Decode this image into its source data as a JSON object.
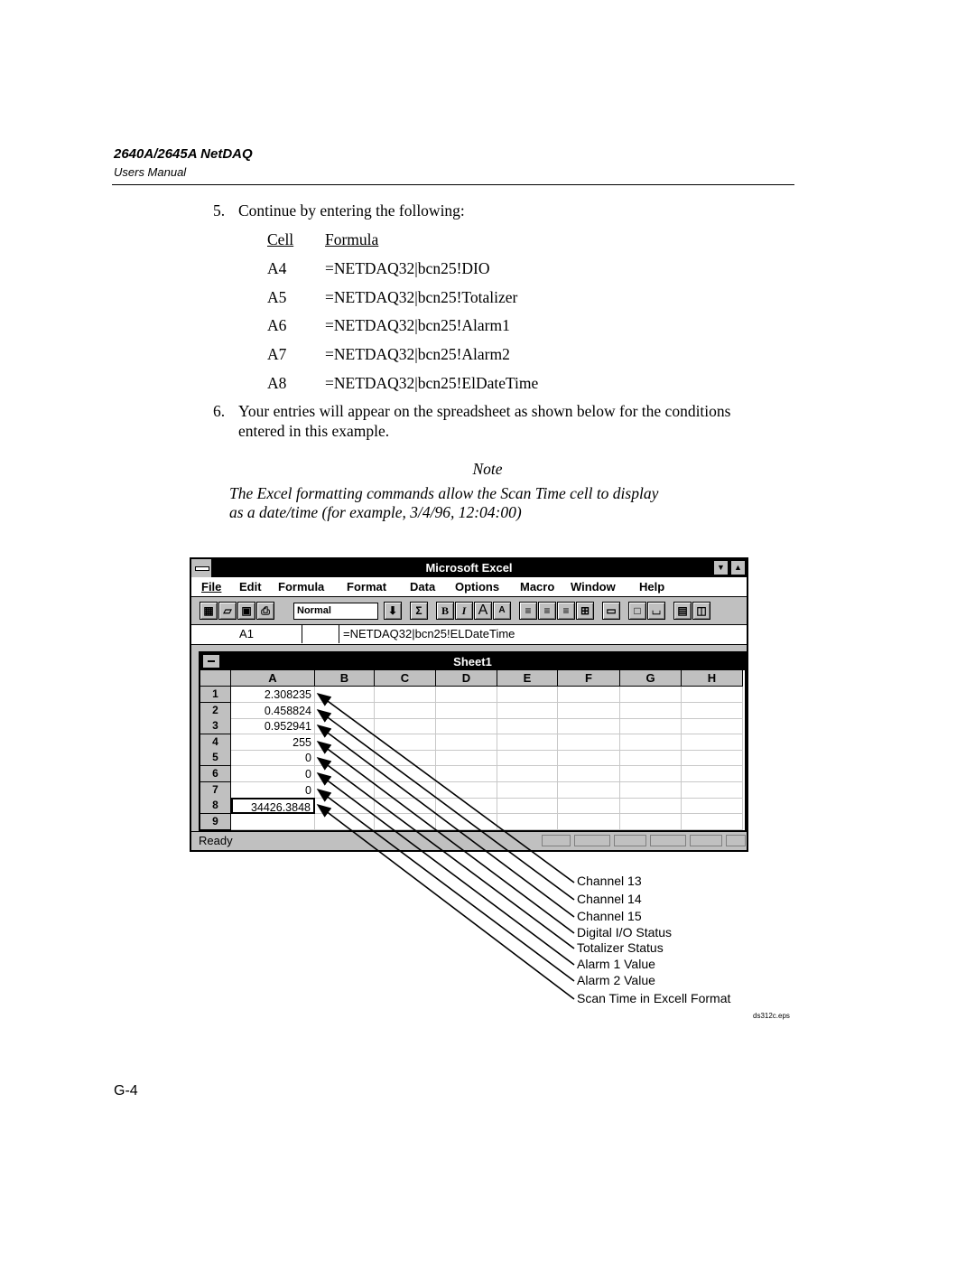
{
  "header": {
    "title": "2640A/2645A NetDAQ",
    "subtitle": "Users Manual"
  },
  "steps": [
    {
      "number": "5.",
      "text": "Continue by entering the following:"
    },
    {
      "number": "6.",
      "lines": [
        "Your entries will appear on the spreadsheet as shown below for the conditions",
        "entered in this example."
      ]
    }
  ],
  "formula_table": {
    "headers": {
      "cell": "Cell",
      "formula": "Formula"
    },
    "rows": [
      {
        "cell": "A4",
        "formula": "=NETDAQ32|bcn25!DIO"
      },
      {
        "cell": "A5",
        "formula": "=NETDAQ32|bcn25!Totalizer"
      },
      {
        "cell": "A6",
        "formula": "=NETDAQ32|bcn25!Alarm1"
      },
      {
        "cell": "A7",
        "formula": "=NETDAQ32|bcn25!Alarm2"
      },
      {
        "cell": "A8",
        "formula": "=NETDAQ32|bcn25!ElDateTime"
      }
    ]
  },
  "note": {
    "title": "Note",
    "lines": [
      "The Excel formatting commands allow the Scan Time cell to display",
      "as a date/time (for example, 3/4/96, 12:04:00)"
    ]
  },
  "excel": {
    "title": "Microsoft Excel",
    "menu": [
      "File",
      "Edit",
      "Formula",
      "Format",
      "Data",
      "Options",
      "Macro",
      "Window",
      "Help"
    ],
    "toolbar": {
      "style_value": "Normal",
      "buttons": [
        "new-sheet",
        "open",
        "save",
        "print",
        "style-dropdown",
        "autosum",
        "bold",
        "italic",
        "increase-font",
        "decrease-font",
        "align-left",
        "align-center",
        "align-right",
        "center-across",
        "outline-border",
        "box-border",
        "bottom-border",
        "text-box",
        "camera"
      ],
      "glyphs": {
        "dropdown": "⬇",
        "sum": "Σ",
        "bold": "B",
        "italic": "I",
        "font_up": "A",
        "font_down": "A"
      }
    },
    "formula_bar": {
      "reference": "A1",
      "content": "=NETDAQ32|bcn25!ELDateTime"
    },
    "sheet": {
      "title": "Sheet1",
      "columns": [
        "A",
        "B",
        "C",
        "D",
        "E",
        "F",
        "G",
        "H"
      ],
      "rows": [
        "1",
        "2",
        "3",
        "4",
        "5",
        "6",
        "7",
        "8",
        "9"
      ],
      "column_a_values": [
        "2.308235",
        "0.458824",
        "0.952941",
        "255",
        "0",
        "0",
        "0",
        "34426.3848",
        ""
      ],
      "active_cell": "A8"
    },
    "status": "Ready"
  },
  "callouts": [
    "Channel 13",
    "Channel 14",
    "Channel 15",
    "Digital I/O Status",
    "Totalizer Status",
    "Alarm 1 Value",
    "Alarm 2 Value",
    "Scan Time in Excell Format"
  ],
  "figure_id": "ds312c.eps",
  "page_number": "G-4"
}
